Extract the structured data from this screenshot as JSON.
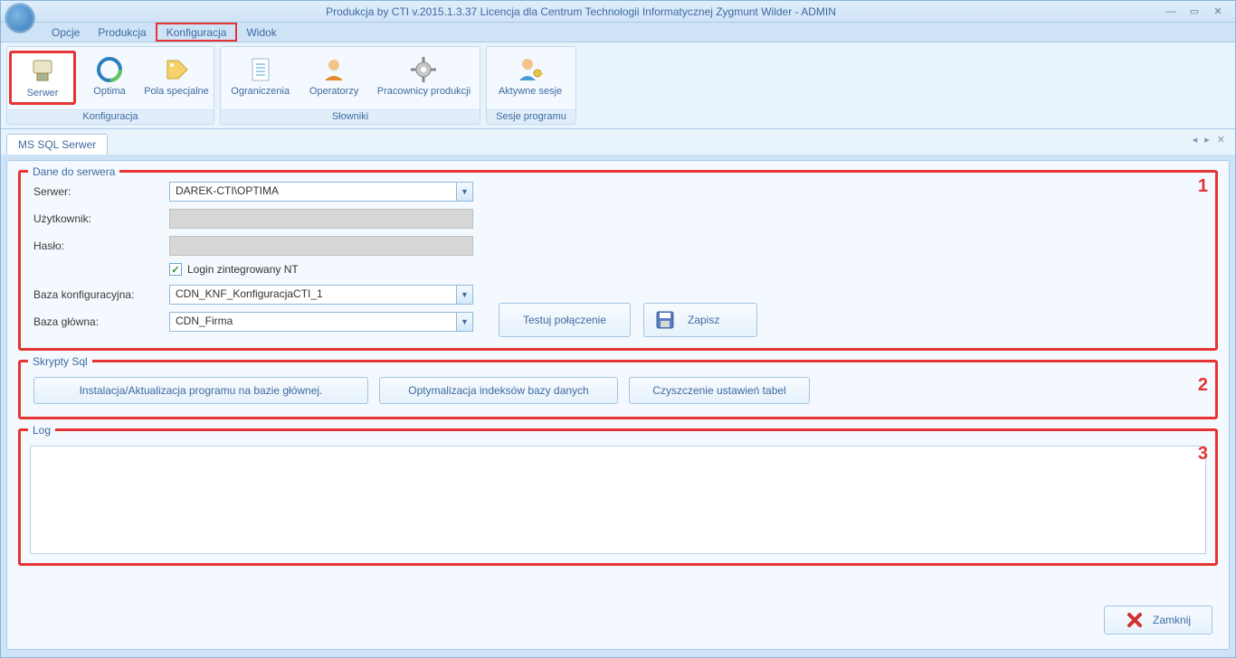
{
  "title": "Produkcja by CTI v.2015.1.3.37 Licencja dla Centrum Technologii Informatycznej Zygmunt Wilder - ADMIN",
  "menu": {
    "opcje": "Opcje",
    "produkcja": "Produkcja",
    "konfiguracja": "Konfiguracja",
    "widok": "Widok"
  },
  "ribbon": {
    "group_konfiguracja": "Konfiguracja",
    "group_slowniki": "Słowniki",
    "group_sesje": "Sesje programu",
    "btn_serwer": "Serwer",
    "btn_optima": "Optima",
    "btn_pola": "Pola specjalne",
    "btn_ograniczenia": "Ograniczenia",
    "btn_operatorzy": "Operatorzy",
    "btn_pracownicy": "Pracownicy produkcji",
    "btn_aktywne": "Aktywne sesje"
  },
  "tab": "MS SQL Serwer",
  "dane": {
    "legend": "Dane do serwera",
    "serwer_label": "Serwer:",
    "serwer_value": "DAREK-CTI\\OPTIMA",
    "user_label": "Użytkownik:",
    "user_value": "",
    "pass_label": "Hasło:",
    "pass_value": "",
    "nt_label": "Login zintegrowany NT",
    "nt_checked": true,
    "bkonf_label": "Baza konfiguracyjna:",
    "bkonf_value": "CDN_KNF_KonfiguracjaCTI_1",
    "bglow_label": "Baza główna:",
    "bglow_value": "CDN_Firma",
    "test_btn": "Testuj połączenie",
    "save_btn": "Zapisz"
  },
  "skrypty": {
    "legend": "Skrypty Sql",
    "b1": "Instalacja/Aktualizacja programu na bazie głównej.",
    "b2": "Optymalizacja indeksów bazy danych",
    "b3": "Czyszczenie ustawień tabel"
  },
  "log_legend": "Log",
  "close": "Zamknij",
  "annot": {
    "a1": "1",
    "a2": "2",
    "a3": "3"
  }
}
